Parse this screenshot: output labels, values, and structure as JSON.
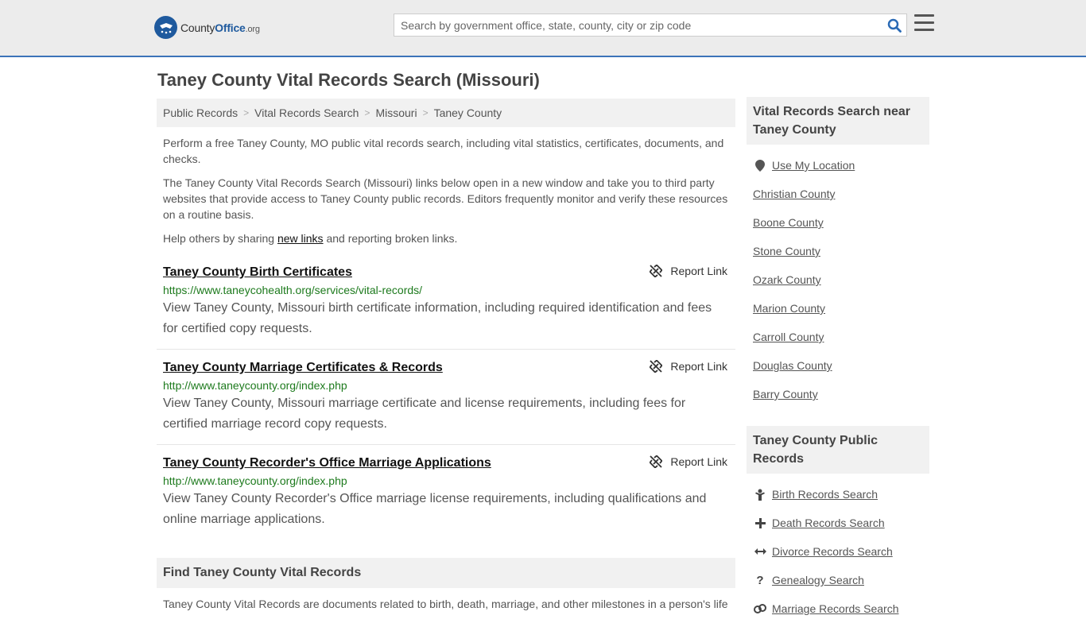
{
  "header": {
    "logo_main": "County",
    "logo_office": "Office",
    "logo_tld": ".org",
    "search_placeholder": "Search by government office, state, county, city or zip code"
  },
  "page": {
    "title": "Taney County Vital Records Search (Missouri)"
  },
  "breadcrumb": [
    "Public Records",
    "Vital Records Search",
    "Missouri",
    "Taney County"
  ],
  "intro": {
    "p1": "Perform a free Taney County, MO public vital records search, including vital statistics, certificates, documents, and checks.",
    "p2": "The Taney County Vital Records Search (Missouri) links below open in a new window and take you to third party websites that provide access to Taney County public records. Editors frequently monitor and verify these resources on a routine basis.",
    "p3_before": "Help others by sharing ",
    "p3_link": "new links",
    "p3_after": " and reporting broken links."
  },
  "results": [
    {
      "title": "Taney County Birth Certificates",
      "url": "https://www.taneycohealth.org/services/vital-records/",
      "desc": "View Taney County, Missouri birth certificate information, including required identification and fees for certified copy requests.",
      "report": "Report Link"
    },
    {
      "title": "Taney County Marriage Certificates & Records",
      "url": "http://www.taneycounty.org/index.php",
      "desc": "View Taney County, Missouri marriage certificate and license requirements, including fees for certified marriage record copy requests.",
      "report": "Report Link"
    },
    {
      "title": "Taney County Recorder's Office Marriage Applications",
      "url": "http://www.taneycounty.org/index.php",
      "desc": "View Taney County Recorder's Office marriage license requirements, including qualifications and online marriage applications.",
      "report": "Report Link"
    }
  ],
  "find": {
    "heading": "Find Taney County Vital Records",
    "text": "Taney County Vital Records are documents related to birth, death, marriage, and other milestones in a person's life"
  },
  "sidebar_near": {
    "heading": "Vital Records Search near Taney County",
    "location": "Use My Location",
    "items": [
      "Christian County",
      "Boone County",
      "Stone County",
      "Ozark County",
      "Marion County",
      "Carroll County",
      "Douglas County",
      "Barry County"
    ]
  },
  "sidebar_public": {
    "heading": "Taney County Public Records",
    "items": [
      {
        "label": "Birth Records Search",
        "icon": "baby-icon"
      },
      {
        "label": "Death Records Search",
        "icon": "cross-icon"
      },
      {
        "label": "Divorce Records Search",
        "icon": "split-arrows-icon"
      },
      {
        "label": "Genealogy Search",
        "icon": "question-icon"
      },
      {
        "label": "Marriage Records Search",
        "icon": "rings-icon"
      }
    ]
  }
}
